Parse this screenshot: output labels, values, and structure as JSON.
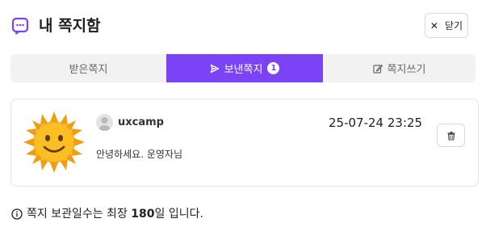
{
  "header": {
    "title": "내 쪽지함",
    "close_label": "닫기"
  },
  "tabs": [
    {
      "label": "받은쪽지",
      "active": false
    },
    {
      "label": "보낸쪽지",
      "active": true,
      "badge": "1"
    },
    {
      "label": "쪽지쓰기",
      "active": false
    }
  ],
  "message": {
    "username": "uxcamp",
    "datetime": "25-07-24 23:25",
    "body": "안녕하세요. 운영자님"
  },
  "notice": {
    "prefix": "쪽지 보관일수는 최장 ",
    "days": "180",
    "suffix": "일 입니다."
  },
  "colors": {
    "accent": "#7b42f6",
    "tab_bg": "#f2f2f2"
  },
  "icons": {
    "header": "message-icon",
    "close": "close-icon",
    "send": "send-icon",
    "write": "edit-icon",
    "delete": "trash-icon",
    "info": "info-icon"
  }
}
